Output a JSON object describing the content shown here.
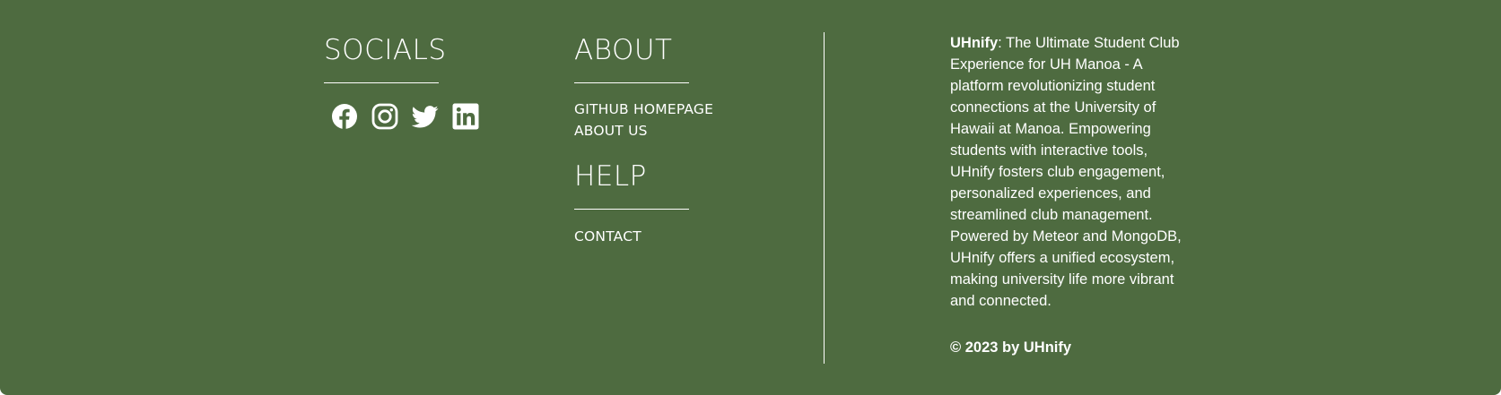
{
  "socials": {
    "heading": "SOCIALS",
    "icons": [
      "facebook-icon",
      "instagram-icon",
      "twitter-icon",
      "linkedin-icon"
    ]
  },
  "about": {
    "heading": "ABOUT",
    "links": [
      "GITHUB HOMEPAGE",
      "ABOUT US"
    ]
  },
  "help": {
    "heading": "HELP",
    "links": [
      "CONTACT"
    ]
  },
  "description": {
    "brand": "UHnify",
    "text": ": The Ultimate Student Club Experience for UH Manoa - A platform revolutionizing student connections at the University of Hawaii at Manoa. Empowering students with interactive tools, UHnify fosters club engagement, personalized experiences, and streamlined club management. Powered by Meteor and MongoDB, UHnify offers a unified ecosystem, making university life more vibrant and connected."
  },
  "copyright": "© 2023 by UHnify",
  "colors": {
    "background": "#4e6b40",
    "text": "#ffffff"
  }
}
